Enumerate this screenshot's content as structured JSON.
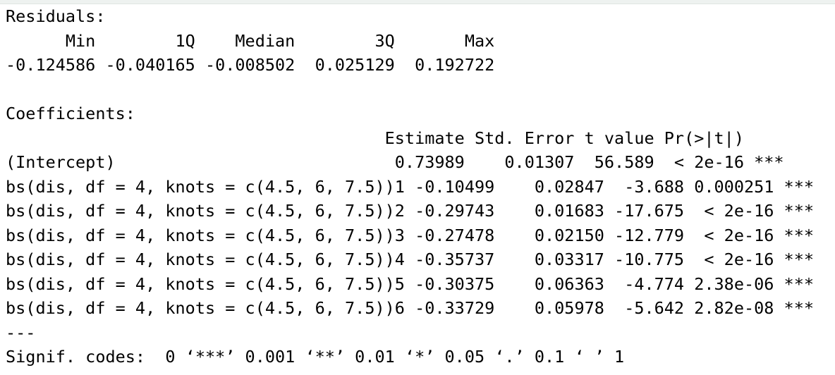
{
  "residuals": {
    "title": "Residuals:",
    "header": "      Min        1Q    Median        3Q       Max ",
    "values": "-0.124586 -0.040165 -0.008502  0.025129  0.192722 "
  },
  "coefficients": {
    "title": "Coefficients:",
    "header": "                                      Estimate Std. Error t value Pr(>|t|)    ",
    "rows": [
      "(Intercept)                            0.73989    0.01307  56.589  < 2e-16 ***",
      "bs(dis, df = 4, knots = c(4.5, 6, 7.5))1 -0.10499    0.02847  -3.688 0.000251 ***",
      "bs(dis, df = 4, knots = c(4.5, 6, 7.5))2 -0.29743    0.01683 -17.675  < 2e-16 ***",
      "bs(dis, df = 4, knots = c(4.5, 6, 7.5))3 -0.27478    0.02150 -12.779  < 2e-16 ***",
      "bs(dis, df = 4, knots = c(4.5, 6, 7.5))4 -0.35737    0.03317 -10.775  < 2e-16 ***",
      "bs(dis, df = 4, knots = c(4.5, 6, 7.5))5 -0.30375    0.06363  -4.774 2.38e-06 ***",
      "bs(dis, df = 4, knots = c(4.5, 6, 7.5))6 -0.33729    0.05978  -5.642 2.82e-08 ***"
    ]
  },
  "separator": "---",
  "signif_codes": "Signif. codes:  0 ‘***’ 0.001 ‘**’ 0.01 ‘*’ 0.05 ‘.’ 0.1 ‘ ’ 1"
}
